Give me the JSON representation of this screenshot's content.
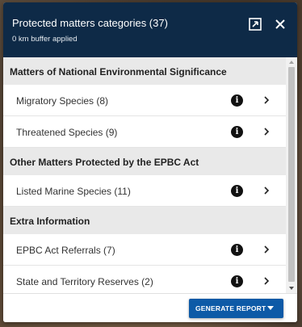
{
  "header": {
    "title": "Protected matters categories (37)",
    "subtitle": "0 km buffer applied"
  },
  "icons": {
    "collapse": "collapse-icon",
    "close": "close-icon",
    "info": "info-icon",
    "chevron": "chevron-right-icon",
    "dropdown": "caret-down-icon"
  },
  "sections": [
    {
      "title": "Matters of National Environmental Significance",
      "items": [
        {
          "label": "Migratory Species (8)"
        },
        {
          "label": "Threatened Species (9)"
        }
      ]
    },
    {
      "title": "Other Matters Protected by the EPBC Act",
      "items": [
        {
          "label": "Listed Marine Species (11)"
        }
      ]
    },
    {
      "title": "Extra Information",
      "items": [
        {
          "label": "EPBC Act Referrals (7)"
        },
        {
          "label": "State and Territory Reserves (2)"
        }
      ]
    }
  ],
  "footer": {
    "generate_label": "GENERATE REPORT"
  },
  "colors": {
    "header_bg": "#0e2a47",
    "button_bg": "#0d5aa7",
    "section_bg": "#e9e9e9"
  }
}
